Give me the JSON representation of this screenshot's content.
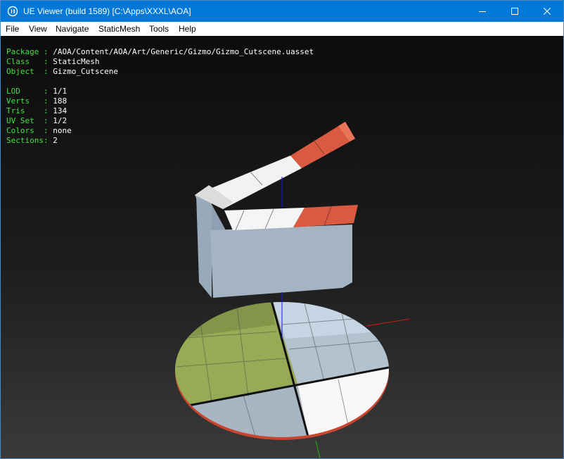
{
  "window": {
    "title": "UE Viewer (build 1589) [C:\\Apps\\XXXL\\AOA]",
    "icon": "unreal-engine-logo"
  },
  "menu": [
    {
      "label": "File"
    },
    {
      "label": "View"
    },
    {
      "label": "Navigate"
    },
    {
      "label": "StaticMesh"
    },
    {
      "label": "Tools"
    },
    {
      "label": "Help"
    }
  ],
  "asset_info": [
    {
      "label": "Package",
      "value": "/AOA/Content/AOA/Art/Generic/Gizmo/Gizmo_Cutscene.uasset"
    },
    {
      "label": "Class",
      "value": "StaticMesh"
    },
    {
      "label": "Object",
      "value": "Gizmo_Cutscene"
    }
  ],
  "mesh_stats": [
    {
      "label": "LOD",
      "value": "1/1"
    },
    {
      "label": "Verts",
      "value": "188"
    },
    {
      "label": "Tris",
      "value": "134"
    },
    {
      "label": "UV Set",
      "value": "1/2"
    },
    {
      "label": "Colors",
      "value": "none"
    },
    {
      "label": "Sections",
      "value": "2"
    }
  ],
  "colors": {
    "titlebar": "#0078d7",
    "info_label": "#3ee23e",
    "info_value": "#ffffff",
    "clapper_white": "#f2f2f2",
    "clapper_orange": "#d95a40",
    "slate_body": "#a4b4c3",
    "base_olive": "#98aa55",
    "base_blue_gray": "#b2c2cf",
    "base_white": "#f8f8f8",
    "axis_x": "#d01818",
    "axis_y": "#18b818",
    "axis_z": "#1818d0"
  }
}
